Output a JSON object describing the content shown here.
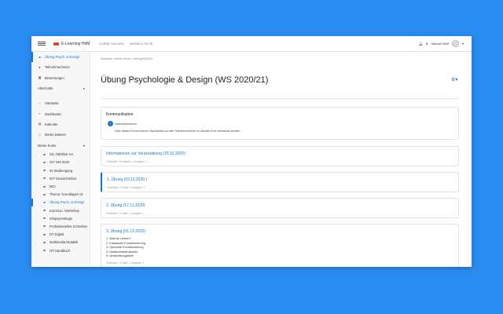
{
  "topbar": {
    "brand": "E-Learning HdM",
    "nav": [
      "KURSE SUCHEN",
      "MOODLE HILFE"
    ],
    "user_name": "Samuel Wolf"
  },
  "sidebar": {
    "course_items": [
      {
        "label": "Übung Psych. & Design",
        "icon": "graduation-cap-icon",
        "active": true
      },
      {
        "label": "Teilnehmer/innen",
        "icon": "users-icon"
      },
      {
        "label": "Bewertungen",
        "icon": "table-icon"
      }
    ],
    "sections_label": "Abschnitte",
    "nav_items": [
      {
        "label": "Startseite",
        "icon": "home-icon"
      },
      {
        "label": "Dashboard",
        "icon": "dashboard-icon"
      },
      {
        "label": "Kalender",
        "icon": "calendar-icon"
      },
      {
        "label": "Meine Dateien",
        "icon": "file-icon"
      }
    ],
    "my_courses_label": "Meine Kurse",
    "courses": [
      {
        "label": "IOL Tafelfest IvA"
      },
      {
        "label": "IGT WS 2020"
      },
      {
        "label": "ID-Studiengang"
      },
      {
        "label": "IDT Kleinschreiber"
      },
      {
        "label": "MCI"
      },
      {
        "label": "Thema: Grundlagen ID"
      },
      {
        "label": "Übung Psych. & Design",
        "active": true
      },
      {
        "label": "Kommun. Workshop"
      },
      {
        "label": "Infopsychologie"
      },
      {
        "label": "Professionelles Schreiben"
      },
      {
        "label": "DT Digital"
      },
      {
        "label": "Multimedia Didaktik"
      },
      {
        "label": "OT-Handbuch"
      }
    ]
  },
  "main": {
    "breadcrumb": "Startseite  /  Meine Kurse  /  ÜbungPsD2021",
    "title": "Übung Psychologie & Design (WS 2020/21)",
    "comm": {
      "heading": "Kommunikation",
      "forum_label": "Nachrichtenforum",
      "forum_desc": "Über dieses Forum können Nachrichten an alle Teilnehmer/innen im Moodle-Kurs verschickt werden."
    },
    "sections": [
      {
        "title": "Informationen zur Veranstaltung (20.10.2020)",
        "meta": "Textfelder: 8  Dateien: 1  Aufgabe: 1"
      },
      {
        "title": "1. Übung (03.11.2020 )",
        "meta": "Textfelder: 2  Datei: 1  Aufgabe: 1"
      },
      {
        "title": "2. Übung (17.11.2020)",
        "meta": "Textfelder: 2  Datei: 1  Aufgabe: 1"
      },
      {
        "title": "3. Übung (01.12.2020)",
        "meta": "Textfelder: 2  Datei: 1  Aufgabe: 1",
        "items": [
          "1. Was ist Lernen?",
          "2. Klassische Konditionierung",
          "3. Operante Konditionierung",
          "4. Gedächtnisstrukturen",
          "5. Verarbeitungstiefe"
        ]
      }
    ]
  }
}
